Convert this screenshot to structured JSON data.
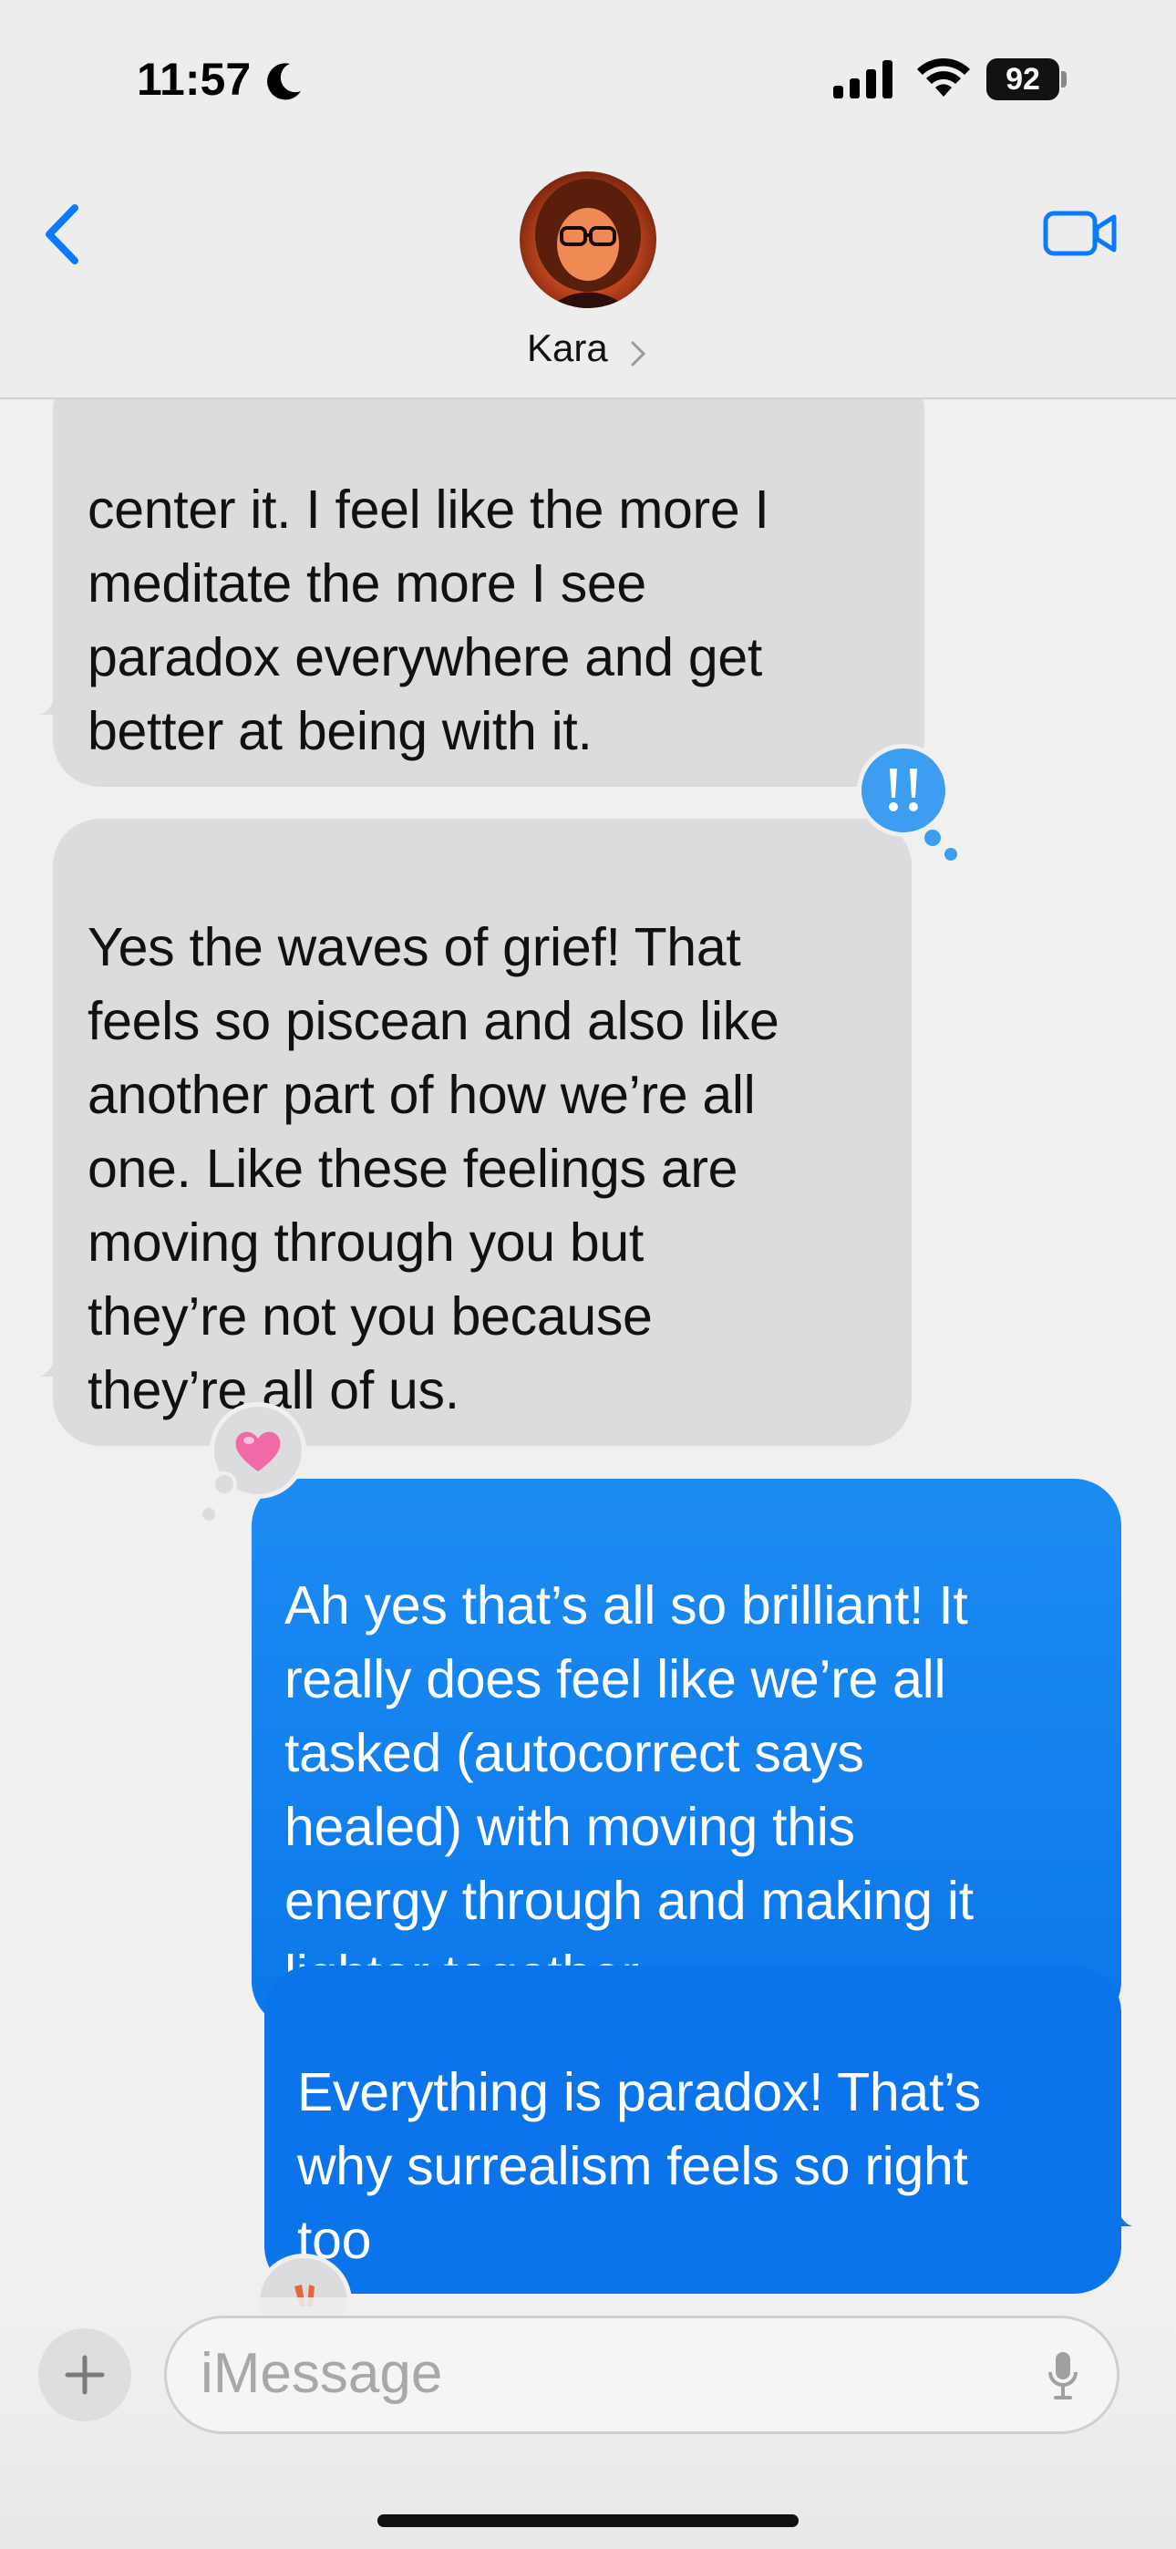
{
  "status_bar": {
    "time": "11:57",
    "battery": "92"
  },
  "nav": {
    "contact_name": "Kara"
  },
  "messages": [
    {
      "id": "m1",
      "from": "contact",
      "text": "center it. I feel like the more I\nmeditate the more I see\nparadox everywhere and get\nbetter at being with it."
    },
    {
      "id": "m2",
      "from": "contact",
      "text": "Yes the waves of grief! That\nfeels so piscean and also like\nanother part of how we’re all\none. Like these feelings are\nmoving through you but\nthey’re not you because\nthey’re all of us.",
      "reaction": "!!"
    },
    {
      "id": "m3",
      "from": "me",
      "text": "Ah yes that’s all so brilliant! It\nreally does feel like we’re all\ntasked (autocorrect says\nhealed) with moving this\nenergy through and making it\nlighter together",
      "reaction": "heart"
    },
    {
      "id": "m4",
      "from": "me",
      "text": "Everything is paradox! That’s\nwhy surrealism feels so right\ntoo"
    }
  ],
  "input": {
    "placeholder": "iMessage"
  },
  "colors": {
    "accent": "#0a7aff",
    "sent_bubble": "#1a86f0",
    "received_bubble": "#dcdcde",
    "reaction_exclaim": "#3d9df0",
    "heart": "#f06aa8"
  },
  "icons": [
    "moon-icon",
    "signal-icon",
    "wifi-icon",
    "battery-icon",
    "back-chevron-icon",
    "video-camera-icon",
    "chevron-right-icon",
    "plus-icon",
    "microphone-icon",
    "exclamation-reaction-icon",
    "heart-reaction-icon",
    "peace-reaction-icon"
  ]
}
